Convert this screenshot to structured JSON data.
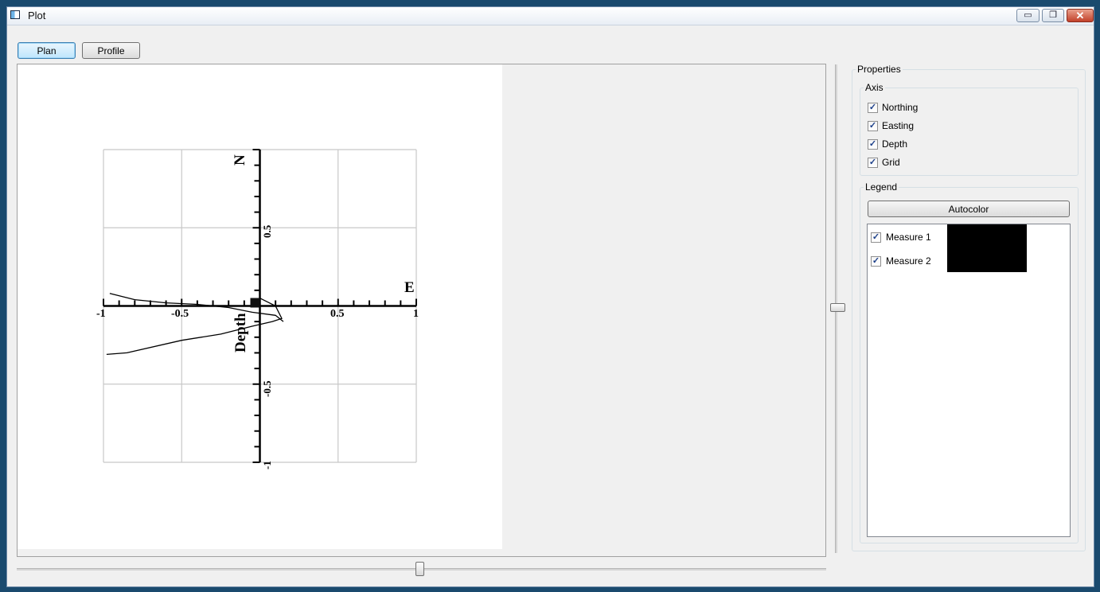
{
  "window": {
    "title": "Plot",
    "controls": {
      "minimize": "▭",
      "restore": "❐",
      "close": "✕"
    }
  },
  "toolbar": {
    "plan_label": "Plan",
    "profile_label": "Profile",
    "active": "Plan"
  },
  "plot": {
    "north_label": "N",
    "east_label": "E",
    "depth_label": "Depth",
    "ticks": {
      "x_neg1": "-1",
      "x_neg05": "-0.5",
      "x_pos05": "0.5",
      "x_pos1": "1",
      "y_pos05": "0.5",
      "y_neg05": "-0.5",
      "y_neg1": "-1"
    }
  },
  "chart_data": {
    "type": "line",
    "grid": true,
    "xlim": [
      -1,
      1
    ],
    "ylim": [
      -1,
      1
    ],
    "x_ticks": [
      "-1",
      "-0.5",
      "0.5",
      "1"
    ],
    "y_ticks": [
      "0.5",
      "-0.5",
      "-1"
    ],
    "series": [
      {
        "name": "Measure 1",
        "color": "#000000",
        "x": [
          -0.96,
          -0.8,
          -0.6,
          -0.4,
          -0.2,
          -0.05,
          0.1,
          0.15
        ],
        "y": [
          0.08,
          0.04,
          0.02,
          0.01,
          -0.01,
          -0.04,
          -0.06,
          -0.1
        ]
      },
      {
        "name": "Measure 2",
        "color": "#000000",
        "x": [
          -0.98,
          -0.85,
          -0.5,
          -0.25,
          -0.05,
          0.08,
          0.14,
          0.1,
          0.0,
          -0.03
        ],
        "y": [
          -0.31,
          -0.3,
          -0.22,
          -0.18,
          -0.13,
          -0.1,
          -0.08,
          0.0,
          0.05,
          0.01
        ]
      }
    ]
  },
  "properties": {
    "title": "Properties",
    "axis": {
      "title": "Axis",
      "items": [
        {
          "label": "Northing",
          "checked": true
        },
        {
          "label": "Easting",
          "checked": true
        },
        {
          "label": "Depth",
          "checked": true
        },
        {
          "label": "Grid",
          "checked": true
        }
      ]
    },
    "legend": {
      "title": "Legend",
      "autocolor_label": "Autocolor",
      "items": [
        {
          "label": "Measure 1",
          "checked": true,
          "color": "#000000"
        },
        {
          "label": "Measure 2",
          "checked": true,
          "color": "#000000"
        }
      ]
    }
  },
  "check_glyph": "✓"
}
